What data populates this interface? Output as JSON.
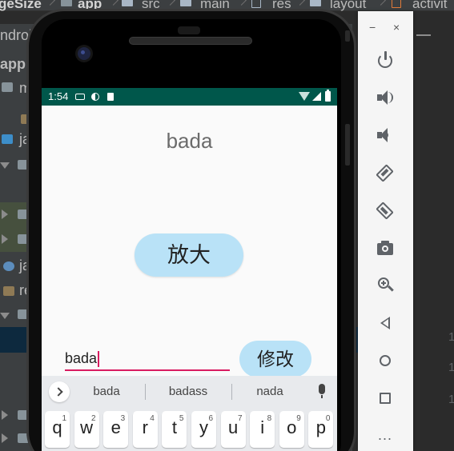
{
  "ide": {
    "breadcrumbs": [
      "geSize",
      "app",
      "src",
      "main",
      "res",
      "layout",
      "activit"
    ],
    "project_header": "ndroi",
    "tree_items": [
      "app",
      "m",
      "ja",
      "ja",
      "re"
    ],
    "gutter_numbers": [
      "1",
      "1",
      "1"
    ]
  },
  "emulator_panel": {
    "minimize_label": "−",
    "close_label": "×",
    "controls": [
      "power",
      "volume-up",
      "volume-down",
      "rotate-left",
      "rotate-right",
      "screenshot",
      "zoom",
      "back",
      "home",
      "overview",
      "more"
    ],
    "more_label": "..."
  },
  "device": {
    "status_bar": {
      "time": "1:54"
    },
    "app": {
      "display_text": "bada",
      "zoom_button_label": "放大",
      "input_value": "bada",
      "modify_button_label": "修改"
    },
    "keyboard": {
      "suggestions": [
        "bada",
        "badass",
        "nada"
      ],
      "row1": [
        {
          "letter": "q",
          "num": "1"
        },
        {
          "letter": "w",
          "num": "2"
        },
        {
          "letter": "e",
          "num": "3"
        },
        {
          "letter": "r",
          "num": "4"
        },
        {
          "letter": "t",
          "num": "5"
        },
        {
          "letter": "y",
          "num": "6"
        },
        {
          "letter": "u",
          "num": "7"
        },
        {
          "letter": "i",
          "num": "8"
        },
        {
          "letter": "o",
          "num": "9"
        },
        {
          "letter": "p",
          "num": "0"
        }
      ]
    }
  },
  "colors": {
    "status_bar": "#00574b",
    "button_bg": "#b9e2f7",
    "accent": "#d81b60",
    "ide_bg": "#2b2b2b"
  }
}
